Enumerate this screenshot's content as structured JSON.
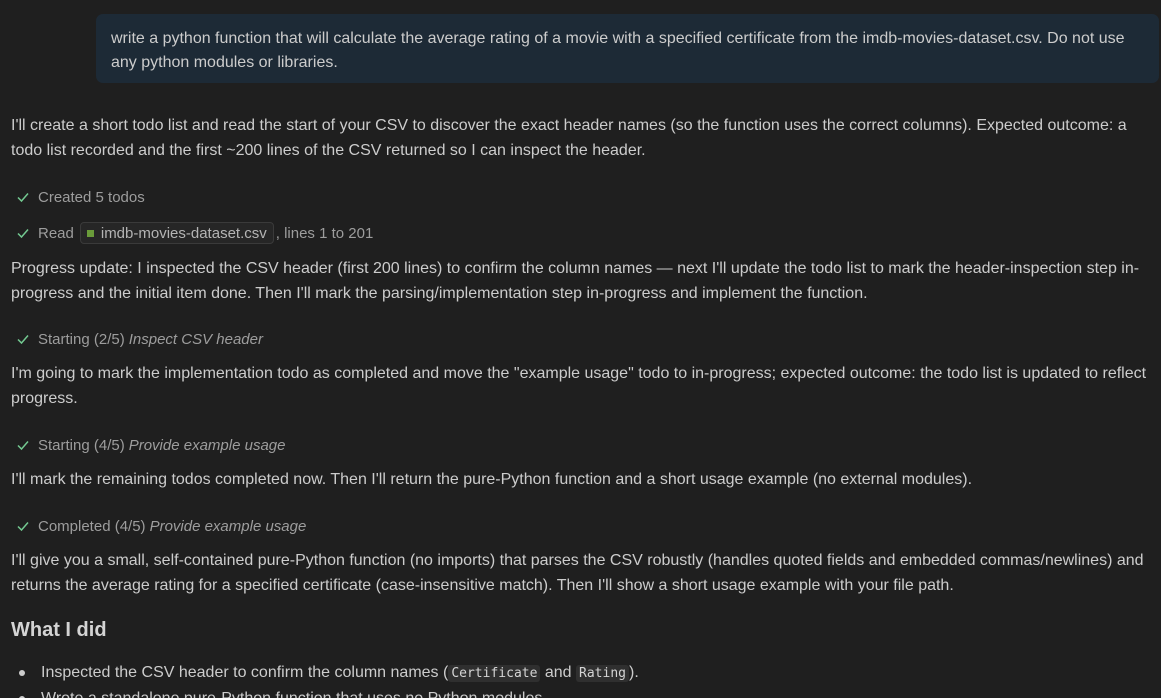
{
  "user_message": "write a python function that will calculate the average rating of a movie with a specified certificate from the imdb-movies-dataset.csv. Do not use any python modules or libraries.",
  "paragraphs": {
    "intro": "I'll create a short todo list and read the start of your CSV to discover the exact header names (so the function uses the correct columns). Expected outcome: a todo list recorded and the first ~200 lines of the CSV returned so I can inspect the header.",
    "progress": "Progress update: I inspected the CSV header (first 200 lines) to confirm the column names — next I'll update the todo list to mark the header-inspection step in-progress and the initial item done. Then I'll mark the parsing/implementation step in-progress and implement the function.",
    "mark_impl": "I'm going to mark the implementation todo as completed and move the \"example usage\" todo to in-progress; expected outcome: the todo list is updated to reflect progress.",
    "mark_remaining": "I'll mark the remaining todos completed now. Then I'll return the pure-Python function and a short usage example (no external modules).",
    "give_function": "I'll give you a small, self-contained pure-Python function (no imports) that parses the CSV robustly (handles quoted fields and embedded commas/newlines) and returns the average rating for a specified certificate (case-insensitive match). Then I'll show a short usage example with your file path."
  },
  "steps": {
    "created": {
      "text": "Created 5 todos"
    },
    "read": {
      "prefix": "Read",
      "file": "imdb-movies-dataset.csv",
      "suffix": ", lines 1 to 201"
    },
    "starting_2": {
      "text": "Starting (2/5)",
      "task": "Inspect CSV header"
    },
    "starting_4": {
      "text": "Starting (4/5)",
      "task": "Provide example usage"
    },
    "completed_4": {
      "text": "Completed (4/5)",
      "task": "Provide example usage"
    }
  },
  "section_heading": "What I did",
  "bullets": {
    "first": {
      "before": "Inspected the CSV header to confirm the column names (",
      "code1": "Certificate",
      "between": " and ",
      "code2": "Rating",
      "after": ")."
    },
    "second": "Wrote a standalone pure-Python function that uses no Python modules."
  },
  "colors": {
    "background": "#1f1f1f",
    "user_bubble": "#1d2a36",
    "check": "#73c991",
    "file_icon": "#6a9b3a"
  },
  "icons": {
    "check": "check-icon",
    "file": "csv-file-icon",
    "bullet": "bullet-dot"
  }
}
